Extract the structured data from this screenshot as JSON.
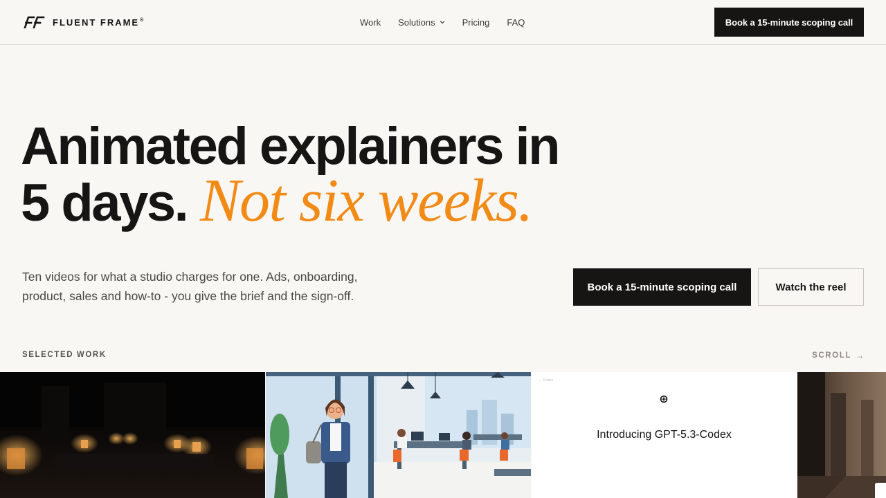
{
  "brand": {
    "name": "FLUENT FRAME",
    "registered_mark": "®",
    "logo_icon": "ff-monogram-icon"
  },
  "nav": {
    "items": [
      {
        "label": "Work"
      },
      {
        "label": "Solutions",
        "has_dropdown": true,
        "icon": "chevron-down-icon"
      },
      {
        "label": "Pricing"
      },
      {
        "label": "FAQ"
      }
    ],
    "cta_label": "Book a 15-minute scoping call"
  },
  "hero": {
    "headline_line1": "Animated explainers in",
    "headline_line2_plain": "5 days.",
    "headline_line2_accent": "Not six weeks.",
    "subcopy": "Ten videos for what a studio charges for one. Ads, onboarding, product, sales and how-to - you give the brief and the sign-off.",
    "primary_cta": "Book a 15-minute scoping call",
    "secondary_cta": "Watch the reel"
  },
  "work": {
    "section_label": "SELECTED WORK",
    "scroll_label": "SCROLL",
    "scroll_icon": "arrow-right-icon",
    "cards": [
      {
        "kind": "video",
        "description_icon": "candlelit-room-thumbnail"
      },
      {
        "kind": "video",
        "description_icon": "office-illustration-thumbnail"
      },
      {
        "kind": "video",
        "title": "Introducing GPT-5.3-Codex",
        "small_caption": "← Codex"
      },
      {
        "kind": "video",
        "description_icon": "hallway-thumbnail"
      }
    ]
  },
  "colors": {
    "background": "#f8f7f4",
    "ink": "#161513",
    "accent": "#f28a16",
    "border": "#dedcd6"
  }
}
